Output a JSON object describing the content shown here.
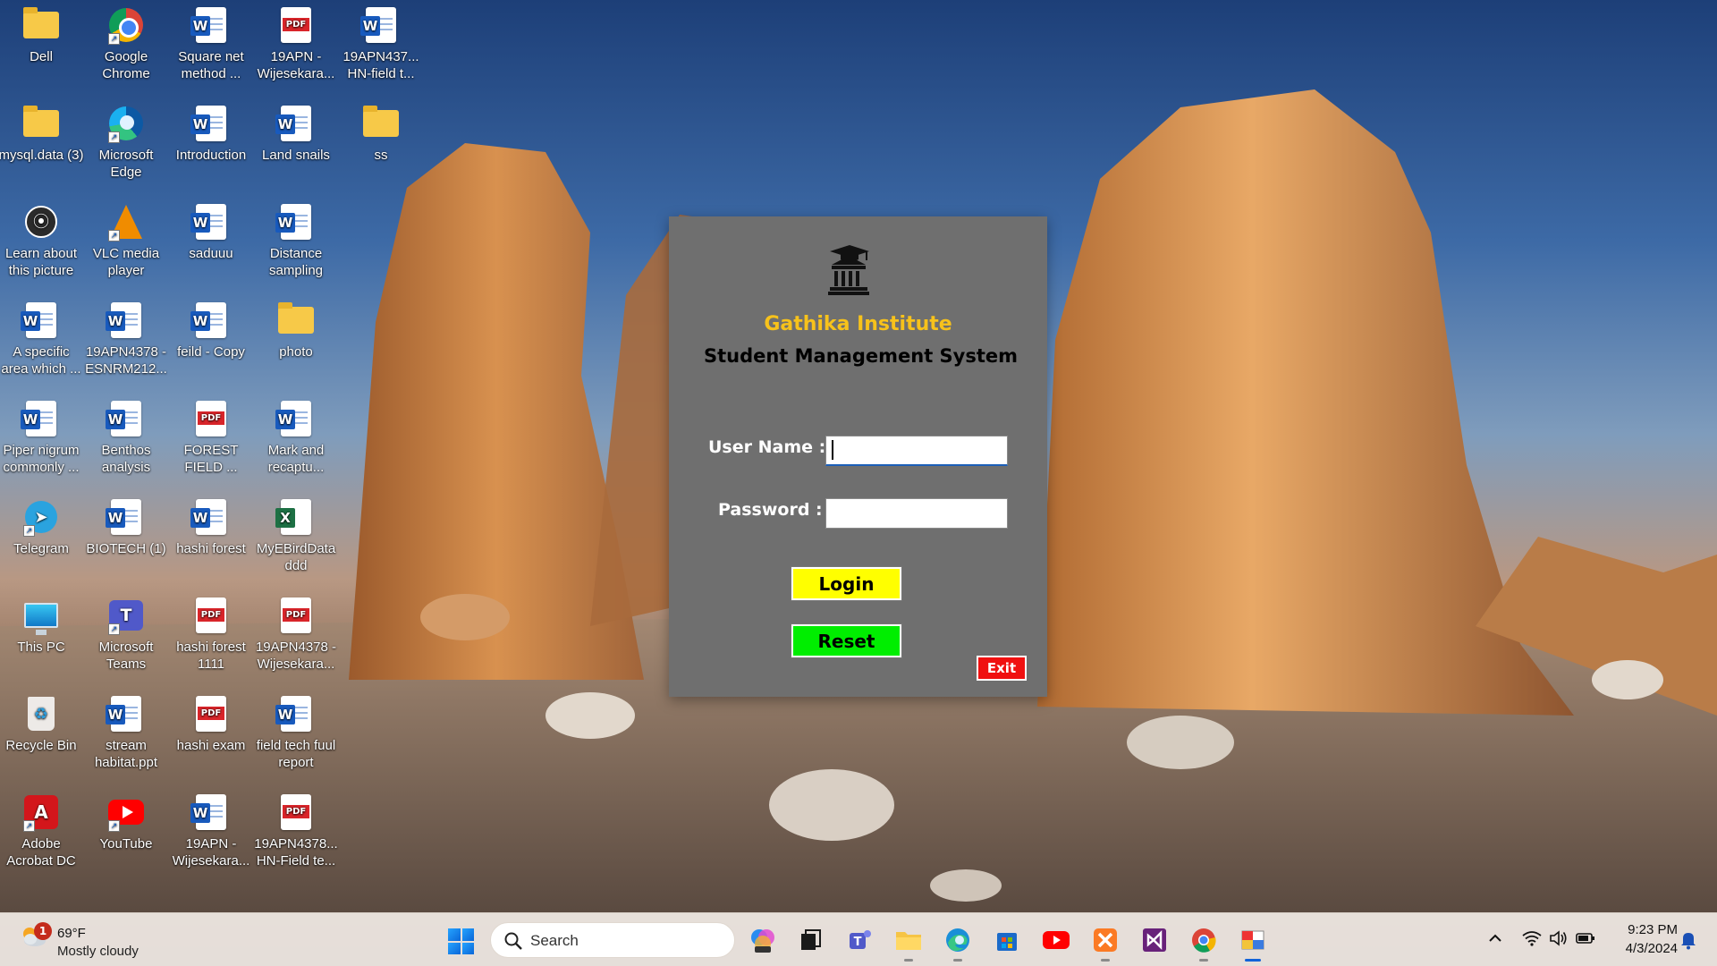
{
  "desktop": {
    "icons": [
      {
        "label": "Dell",
        "type": "folder"
      },
      {
        "label": "Google Chrome",
        "type": "chrome"
      },
      {
        "label": "Square net method ...",
        "type": "word"
      },
      {
        "label": "19APN -Wijesekara...",
        "type": "pdf"
      },
      {
        "label": "19APN437... HN-field t...",
        "type": "word"
      },
      {
        "label": "mysql.data (3)",
        "type": "folder"
      },
      {
        "label": "Microsoft Edge",
        "type": "edge"
      },
      {
        "label": "Introduction",
        "type": "word"
      },
      {
        "label": "Land snails",
        "type": "word"
      },
      {
        "label": "ss",
        "type": "folder"
      },
      {
        "label": "Learn about this picture",
        "type": "spotlight"
      },
      {
        "label": "VLC media player",
        "type": "vlc"
      },
      {
        "label": "saduuu",
        "type": "word"
      },
      {
        "label": "Distance sampling",
        "type": "word"
      },
      {
        "label": "A specific area which ...",
        "type": "word"
      },
      {
        "label": "19APN4378 -ESNRM212...",
        "type": "word"
      },
      {
        "label": "feild - Copy",
        "type": "word"
      },
      {
        "label": "photo",
        "type": "folder"
      },
      {
        "label": "Piper nigrum commonly ...",
        "type": "word"
      },
      {
        "label": "Benthos analysis",
        "type": "word"
      },
      {
        "label": "FOREST FIELD ...",
        "type": "pdf"
      },
      {
        "label": "Mark and recaptu...",
        "type": "word"
      },
      {
        "label": "Telegram",
        "type": "telegram"
      },
      {
        "label": "BIOTECH (1)",
        "type": "word"
      },
      {
        "label": "hashi forest",
        "type": "word"
      },
      {
        "label": "MyEBirdData ddd",
        "type": "excel"
      },
      {
        "label": "This PC",
        "type": "pc"
      },
      {
        "label": "Microsoft Teams",
        "type": "teams"
      },
      {
        "label": "hashi forest 1111",
        "type": "pdf"
      },
      {
        "label": "19APN4378 -Wijesekara...",
        "type": "pdf"
      },
      {
        "label": "Recycle Bin",
        "type": "bin"
      },
      {
        "label": "stream habitat.ppt",
        "type": "word"
      },
      {
        "label": "hashi exam",
        "type": "pdf"
      },
      {
        "label": "field tech fuul report",
        "type": "word"
      },
      {
        "label": "Adobe Acrobat DC",
        "type": "acrobat"
      },
      {
        "label": "YouTube",
        "type": "youtube"
      },
      {
        "label": "19APN -Wijesekara...",
        "type": "word"
      },
      {
        "label": "19APN4378... HN-Field te...",
        "type": "pdf"
      }
    ]
  },
  "login": {
    "institute": "Gathika Institute",
    "system": "Student Management System",
    "username_label": "User Name :",
    "password_label": "Password :",
    "username_value": "",
    "password_value": "",
    "login_label": "Login",
    "reset_label": "Reset",
    "exit_label": "Exit"
  },
  "taskbar": {
    "weather_badge": "1",
    "weather_temp": "69°F",
    "weather_condition": "Mostly cloudy",
    "search_placeholder": "Search",
    "apps": [
      "copilot-icon",
      "task-view-icon",
      "teams-icon",
      "file-explorer-icon",
      "edge-icon",
      "store-icon",
      "youtube-icon",
      "xampp-icon",
      "visual-studio-icon",
      "chrome-icon",
      "java-app-icon"
    ],
    "time": "9:23 PM",
    "date": "4/3/2024"
  }
}
